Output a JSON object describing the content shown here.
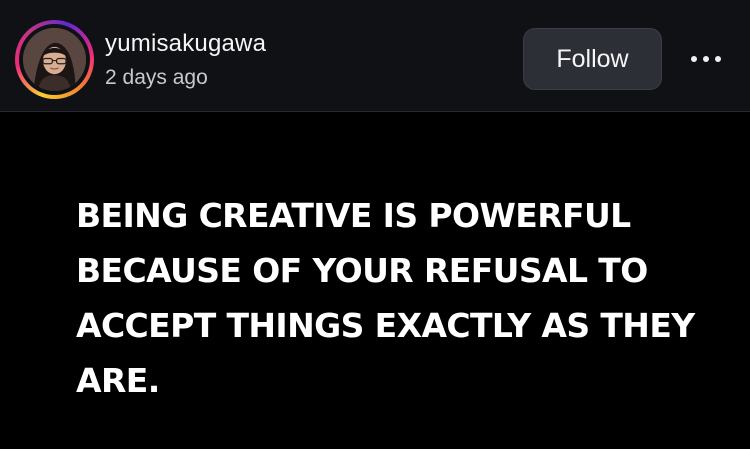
{
  "post_header": {
    "username": "yumisakugawa",
    "timestamp": "2 days ago",
    "follow_label": "Follow",
    "more_icon": "more-horizontal-icon",
    "avatar_ring_colors": [
      "#f9ce34",
      "#ee2a7b",
      "#6228d7"
    ]
  },
  "post": {
    "quote_text": "BEING CREATIVE IS POWERFUL BECAUSE OF YOUR REFUSAL TO ACCEPT THINGS EXACTLY AS THEY ARE.",
    "background_color": "#000000",
    "text_color": "#ffffff"
  }
}
